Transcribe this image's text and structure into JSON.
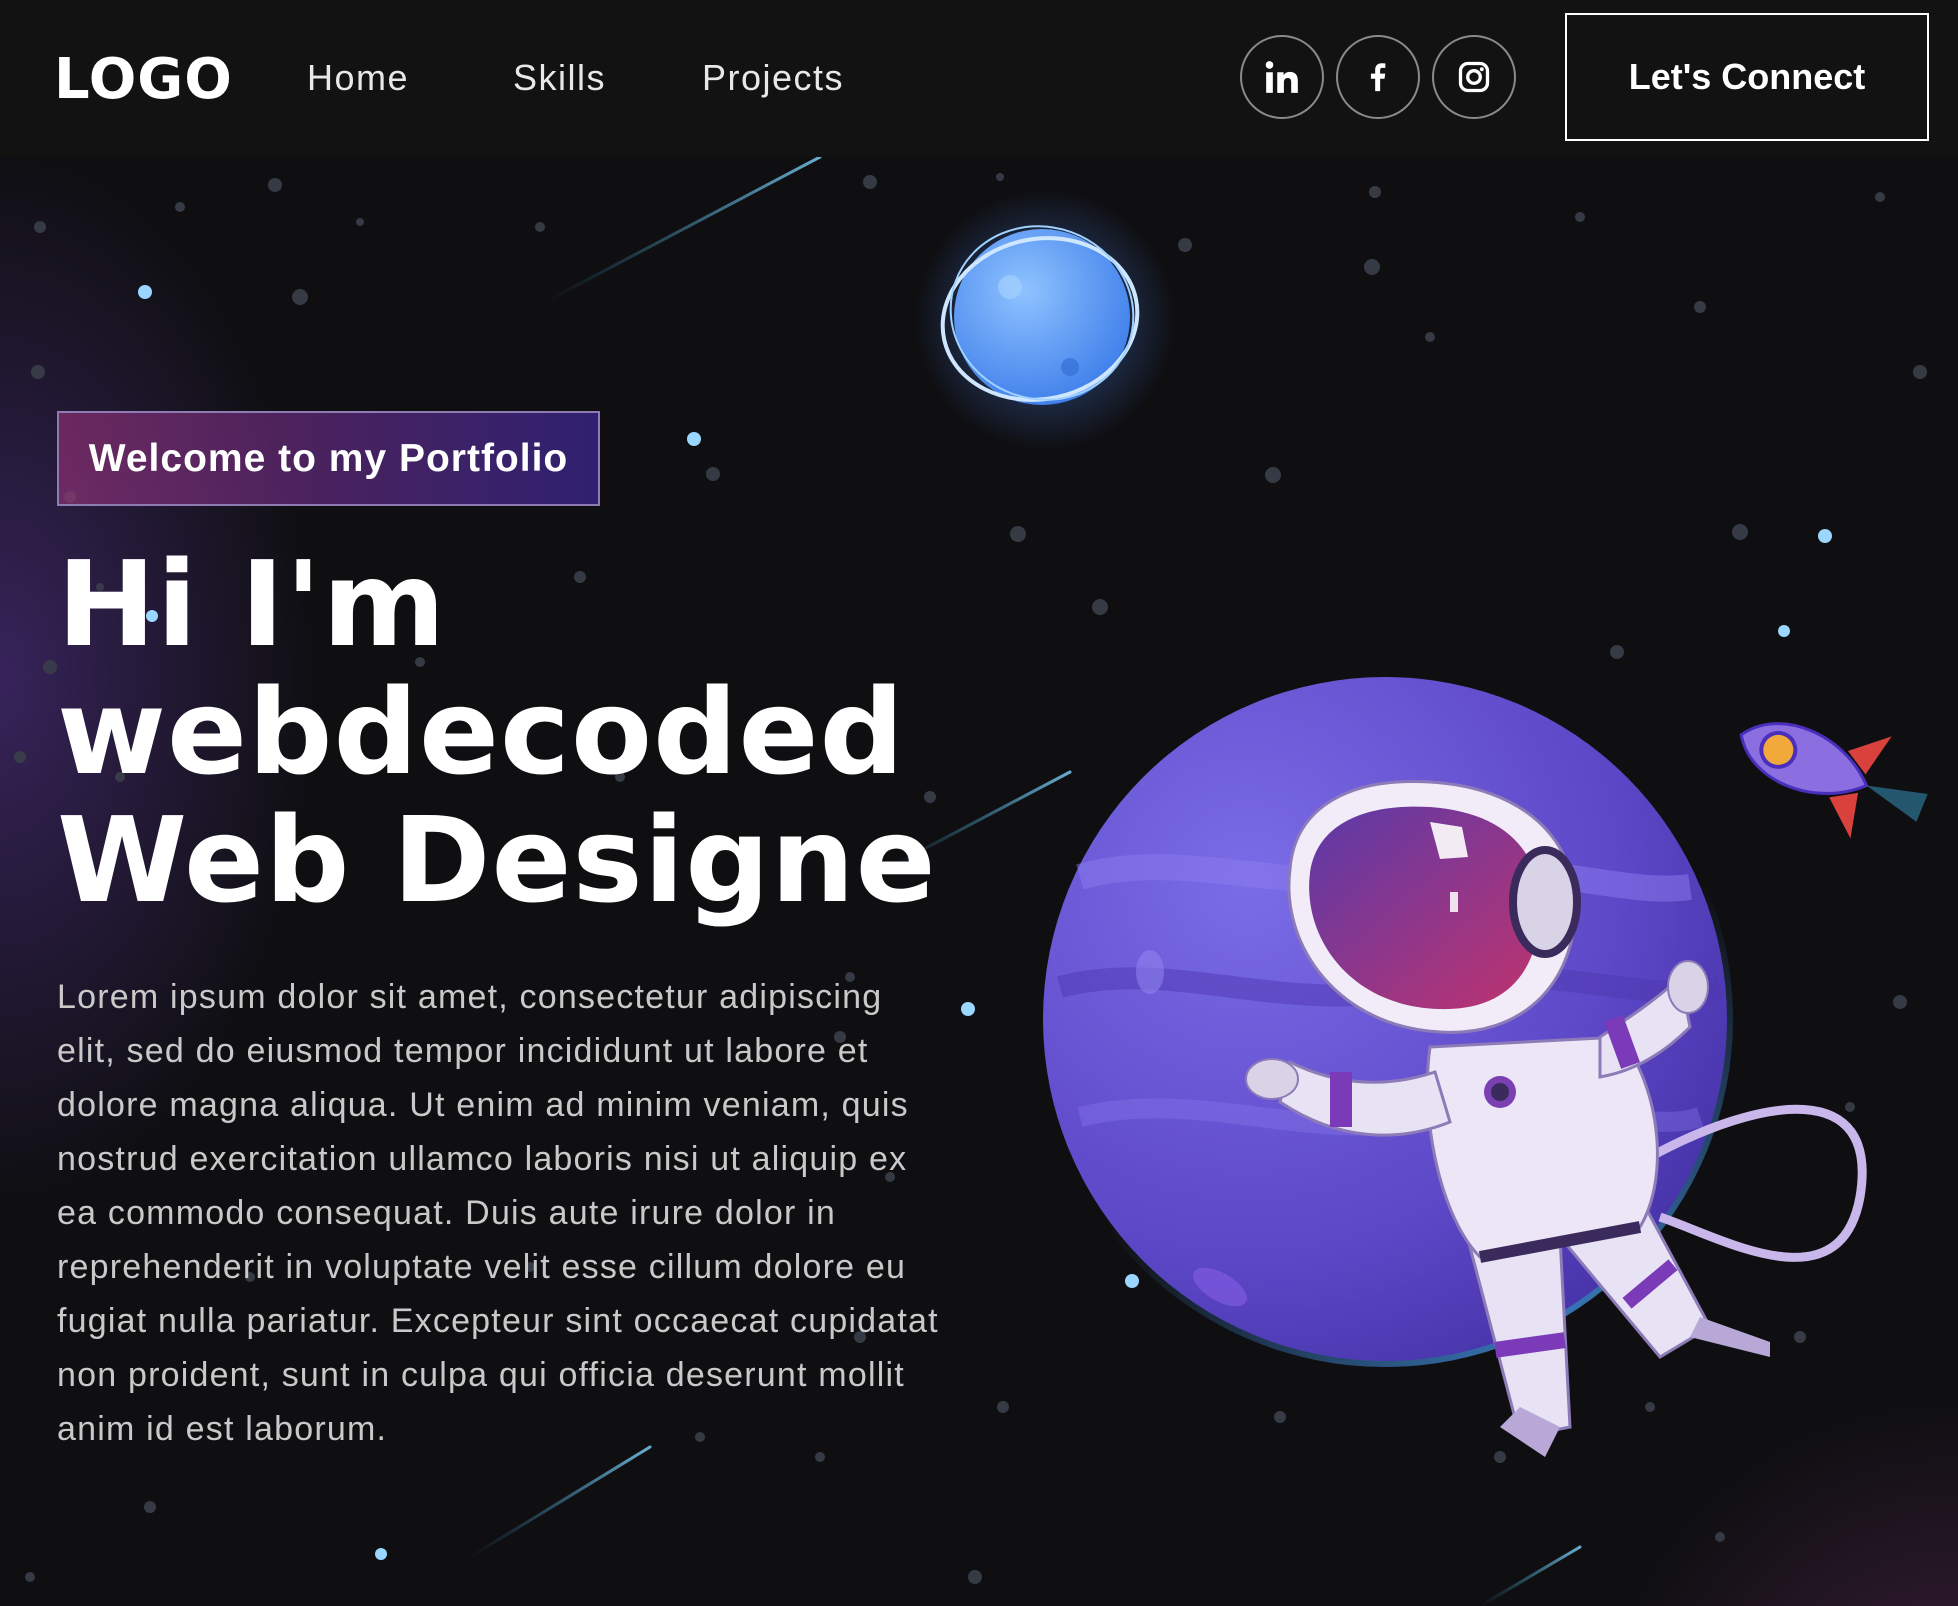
{
  "navbar": {
    "logo": "LOGO",
    "links": [
      {
        "label": "Home"
      },
      {
        "label": "Skills"
      },
      {
        "label": "Projects"
      }
    ],
    "social": [
      {
        "icon": "linkedin-icon",
        "glyph": "in"
      },
      {
        "icon": "facebook-icon",
        "glyph": "f"
      },
      {
        "icon": "instagram-icon",
        "glyph": ""
      }
    ],
    "connect_label": "Let's Connect"
  },
  "hero": {
    "tagline": "Welcome to my Portfolio",
    "headline_line1": "Hi I'm",
    "headline_line2": "webdecoded",
    "headline_line3": "Web Designe",
    "bio": "Lorem ipsum dolor sit amet, consectetur adipiscing elit, sed do eiusmod tempor incididunt ut labore et dolore magna aliqua. Ut enim ad minim veniam, quis nostrud exercitation ullamco laboris nisi ut aliquip ex ea commodo consequat. Duis aute irure dolor in reprehenderit in voluptate velit esse cillum dolore eu fugiat nulla pariatur. Excepteur sint occaecat cupidatat non proident, sunt in culpa qui officia deserunt mollit anim id est laborum."
  },
  "colors": {
    "background": "#121212",
    "accent_purple": "#4a2fbd",
    "accent_pink": "#aa367c",
    "planet": "#6a5ad8",
    "small_planet": "#5aa3ff"
  },
  "illustration": {
    "icons": [
      "blue-planet-icon",
      "purple-planet-icon",
      "astronaut-icon",
      "rocket-icon"
    ]
  }
}
